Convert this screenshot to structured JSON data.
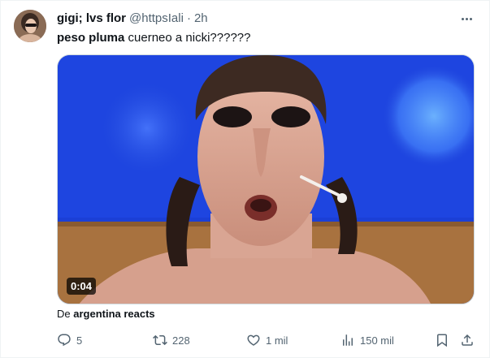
{
  "tweet": {
    "display_name": "gigi; lvs flor",
    "handle": "@httpsIali",
    "separator": "·",
    "time": "2h",
    "text_bold": "peso pluma",
    "text_rest": " cuerneo a nicki??????",
    "more_icon": "more-horizontal-icon"
  },
  "media": {
    "duration": "0:04",
    "source_prefix": "De ",
    "source_name": "argentina reacts"
  },
  "actions": {
    "replies": "5",
    "retweets": "228",
    "likes": "1 mil",
    "views": "150 mil"
  },
  "colors": {
    "text_primary": "#0f1419",
    "text_secondary": "#536471",
    "border": "#cfd9de",
    "video_background_blue": "#1b3fd6"
  }
}
